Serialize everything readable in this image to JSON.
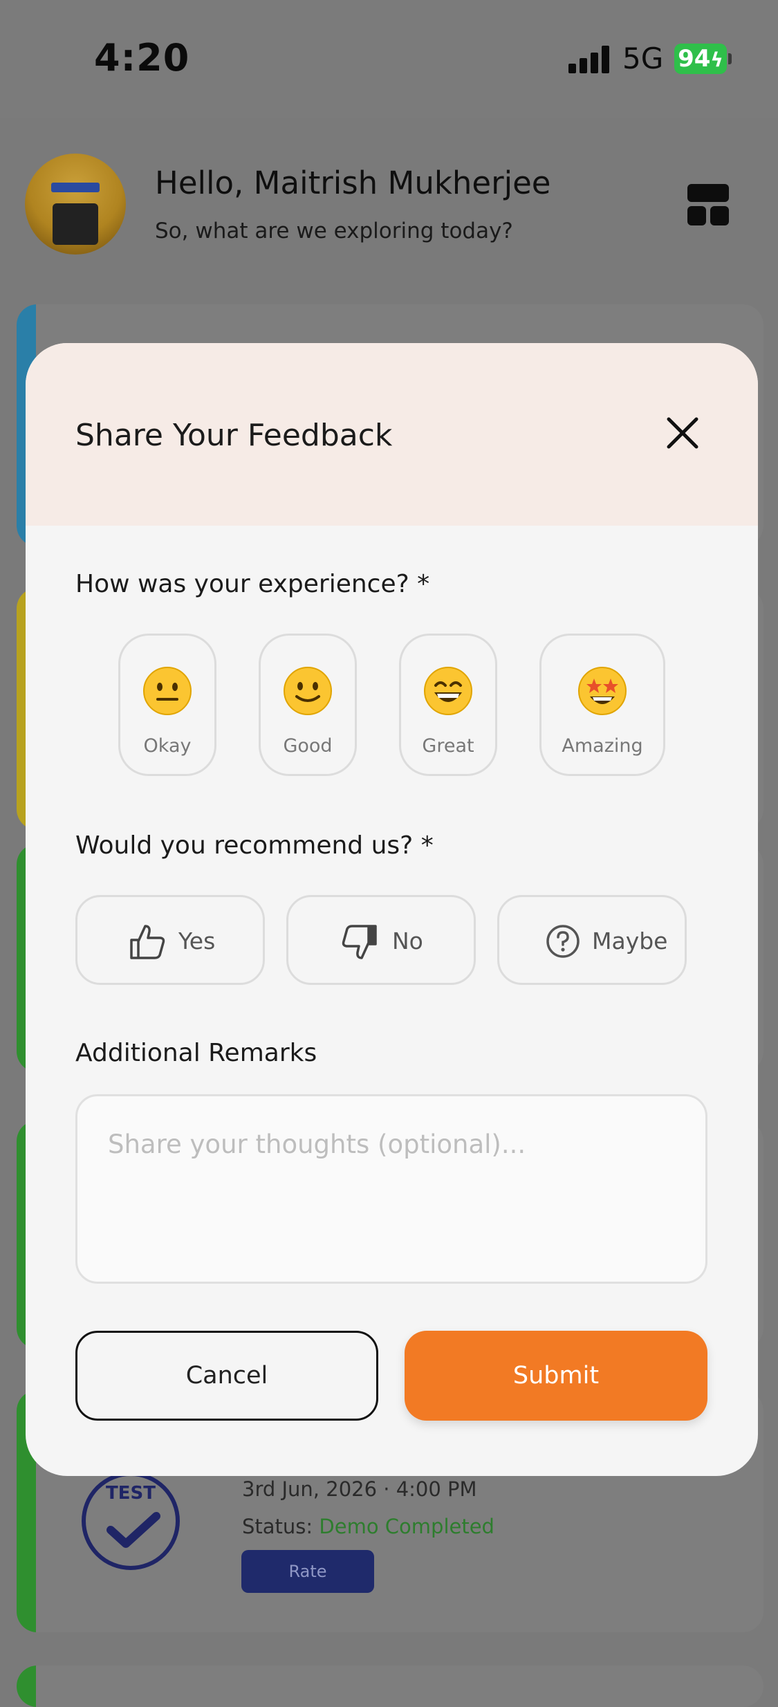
{
  "status_bar": {
    "time": "4:20",
    "network": "5G",
    "battery": "94"
  },
  "header": {
    "greeting": "Hello, Maitrish Mukherjee",
    "subtitle": "So, what are we exploring today?"
  },
  "background_card": {
    "logo_text": "TEST",
    "date_time": "3rd Jun, 2026 · 4:00 PM",
    "status_label": "Status:",
    "status_value": "Demo Completed",
    "rate_label": "Rate"
  },
  "modal": {
    "title": "Share Your Feedback",
    "experience_question": "How was your experience? *",
    "experience_options": [
      {
        "label": "Okay",
        "icon": "neutral-face-icon"
      },
      {
        "label": "Good",
        "icon": "slightly-smiling-face-icon"
      },
      {
        "label": "Great",
        "icon": "grinning-face-icon"
      },
      {
        "label": "Amazing",
        "icon": "star-struck-face-icon"
      }
    ],
    "recommend_question": "Would you recommend us? *",
    "recommend_options": [
      {
        "label": "Yes",
        "icon": "thumbs-up-icon"
      },
      {
        "label": "No",
        "icon": "thumbs-down-icon"
      },
      {
        "label": "Maybe",
        "icon": "question-circle-icon"
      }
    ],
    "remarks_label": "Additional Remarks",
    "remarks_placeholder": "Share your thoughts (optional)...",
    "remarks_value": "",
    "cancel_label": "Cancel",
    "submit_label": "Submit"
  },
  "colors": {
    "overlay": "#7a7a7a",
    "modal_header": "#f6ebe6",
    "submit": "#f27a24",
    "status_green": "#2e7d2e",
    "battery_green": "#2fbf4a",
    "stripe_blue": "#2a7fa8",
    "stripe_yellow": "#b8a21e",
    "stripe_green": "#2f8f2f"
  }
}
